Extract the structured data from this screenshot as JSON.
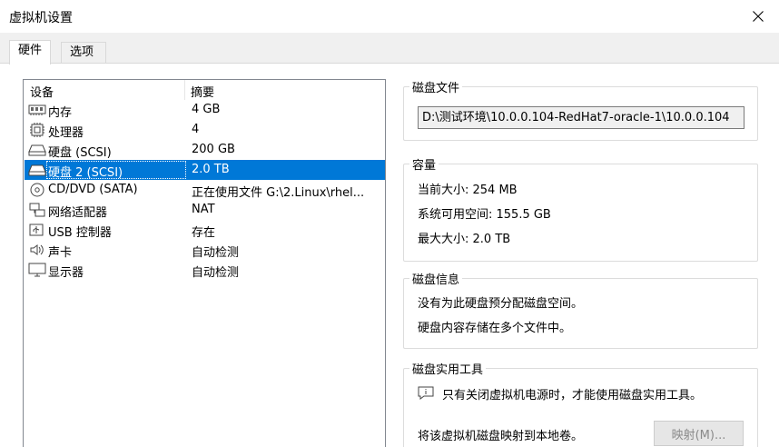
{
  "window": {
    "title": "虚拟机设置"
  },
  "tabs": [
    {
      "label": "硬件",
      "active": true
    },
    {
      "label": "选项",
      "active": false
    }
  ],
  "device_list": {
    "columns": [
      "设备",
      "摘要"
    ],
    "rows": [
      {
        "name": "内存",
        "summary": "4 GB",
        "icon": "memory-icon"
      },
      {
        "name": "处理器",
        "summary": "4",
        "icon": "processor-icon"
      },
      {
        "name": "硬盘 (SCSI)",
        "summary": "200 GB",
        "icon": "hard-disk-icon"
      },
      {
        "name": "硬盘 2 (SCSI)",
        "summary": "2.0 TB",
        "icon": "hard-disk-icon",
        "selected": true
      },
      {
        "name": "CD/DVD (SATA)",
        "summary": "正在使用文件 G:\\2.Linux\\rhel...",
        "icon": "cd-dvd-icon"
      },
      {
        "name": "网络适配器",
        "summary": "NAT",
        "icon": "network-icon"
      },
      {
        "name": "USB 控制器",
        "summary": "存在",
        "icon": "usb-icon"
      },
      {
        "name": "声卡",
        "summary": "自动检测",
        "icon": "speaker-icon"
      },
      {
        "name": "显示器",
        "summary": "自动检测",
        "icon": "monitor-icon"
      }
    ]
  },
  "disk_file": {
    "title": "磁盘文件",
    "path": "D:\\测试环境\\10.0.0.104-RedHat7-oracle-1\\10.0.0.104"
  },
  "capacity": {
    "title": "容量",
    "current_size": "当前大小: 254 MB",
    "available": "系统可用空间: 155.5 GB",
    "max_size": "最大大小: 2.0 TB"
  },
  "disk_info": {
    "title": "磁盘信息",
    "line1": "没有为此硬盘预分配磁盘空间。",
    "line2": "硬盘内容存储在多个文件中。"
  },
  "disk_tools": {
    "title": "磁盘实用工具",
    "notice": "只有关闭虚拟机电源时，才能使用磁盘实用工具。",
    "map_desc": "将该虚拟机磁盘映射到本地卷。",
    "map_button": "映射(M)..."
  }
}
